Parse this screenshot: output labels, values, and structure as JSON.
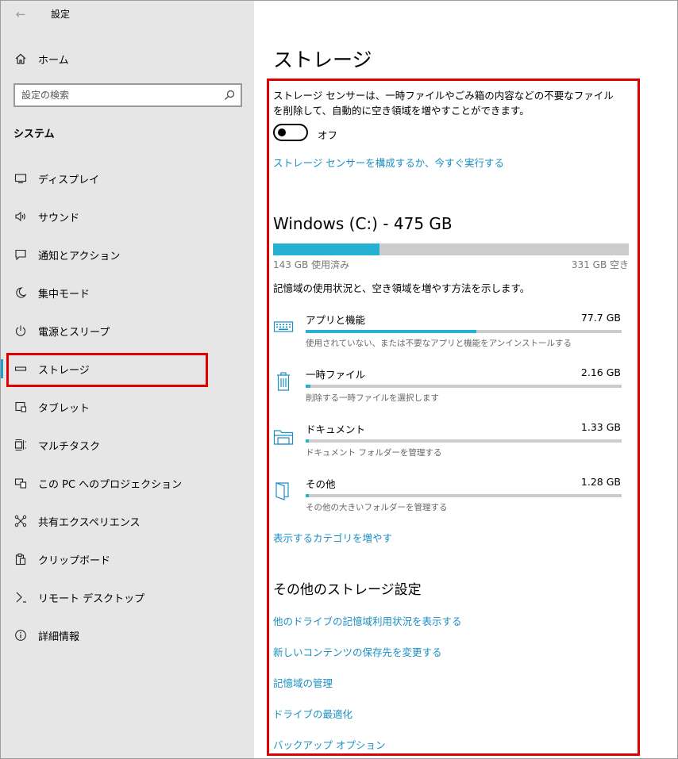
{
  "app": {
    "title": "設定"
  },
  "sidebar": {
    "home_label": "ホーム",
    "search_placeholder": "設定の検索",
    "section_title": "システム",
    "items": [
      {
        "label": "ディスプレイ",
        "icon": "display-icon"
      },
      {
        "label": "サウンド",
        "icon": "sound-icon"
      },
      {
        "label": "通知とアクション",
        "icon": "notification-icon"
      },
      {
        "label": "集中モード",
        "icon": "moon-icon"
      },
      {
        "label": "電源とスリープ",
        "icon": "power-icon"
      },
      {
        "label": "ストレージ",
        "icon": "storage-icon",
        "selected": true
      },
      {
        "label": "タブレット",
        "icon": "tablet-icon"
      },
      {
        "label": "マルチタスク",
        "icon": "multitask-icon"
      },
      {
        "label": "この PC へのプロジェクション",
        "icon": "projection-icon"
      },
      {
        "label": "共有エクスペリエンス",
        "icon": "share-icon"
      },
      {
        "label": "クリップボード",
        "icon": "clipboard-icon"
      },
      {
        "label": "リモート デスクトップ",
        "icon": "remote-desktop-icon"
      },
      {
        "label": "詳細情報",
        "icon": "info-icon"
      }
    ]
  },
  "main": {
    "title": "ストレージ",
    "sense_description": "ストレージ センサーは、一時ファイルやごみ箱の内容などの不要なファイルを削除して、自動的に空き領域を増やすことができます。",
    "toggle": {
      "state_label": "オフ",
      "on": false
    },
    "configure_link": "ストレージ センサーを構成するか、今すぐ実行する",
    "drive": {
      "title": "Windows (C:) - 475 GB",
      "used_label": "143 GB 使用済み",
      "free_label": "331 GB 空き",
      "used_fraction": 0.3
    },
    "usage_description": "記憶域の使用状況と、空き領域を増やす方法を示します。",
    "categories": [
      {
        "name": "アプリと機能",
        "size": "77.7 GB",
        "sub": "使用されていない、または不要なアプリと機能をアンインストールする",
        "fraction": 0.54,
        "icon": "keyboard-icon"
      },
      {
        "name": "一時ファイル",
        "size": "2.16 GB",
        "sub": "削除する一時ファイルを選択します",
        "fraction": 0.015,
        "icon": "trash-icon"
      },
      {
        "name": "ドキュメント",
        "size": "1.33 GB",
        "sub": "ドキュメント フォルダーを管理する",
        "fraction": 0.01,
        "icon": "folder-icon"
      },
      {
        "name": "その他",
        "size": "1.28 GB",
        "sub": "その他の大きいフォルダーを管理する",
        "fraction": 0.01,
        "icon": "other-files-icon"
      }
    ],
    "more_categories_link": "表示するカテゴリを増やす",
    "more_settings_title": "その他のストレージ設定",
    "more_links": [
      "他のドライブの記憶域利用状況を表示する",
      "新しいコンテンツの保存先を変更する",
      "記憶域の管理",
      "ドライブの最適化",
      "バックアップ オプション"
    ]
  },
  "colors": {
    "accent": "#26b1d2",
    "link": "#1b8fc4",
    "highlight_frame": "#e00000",
    "sidebar_bg": "#e6e6e6"
  }
}
